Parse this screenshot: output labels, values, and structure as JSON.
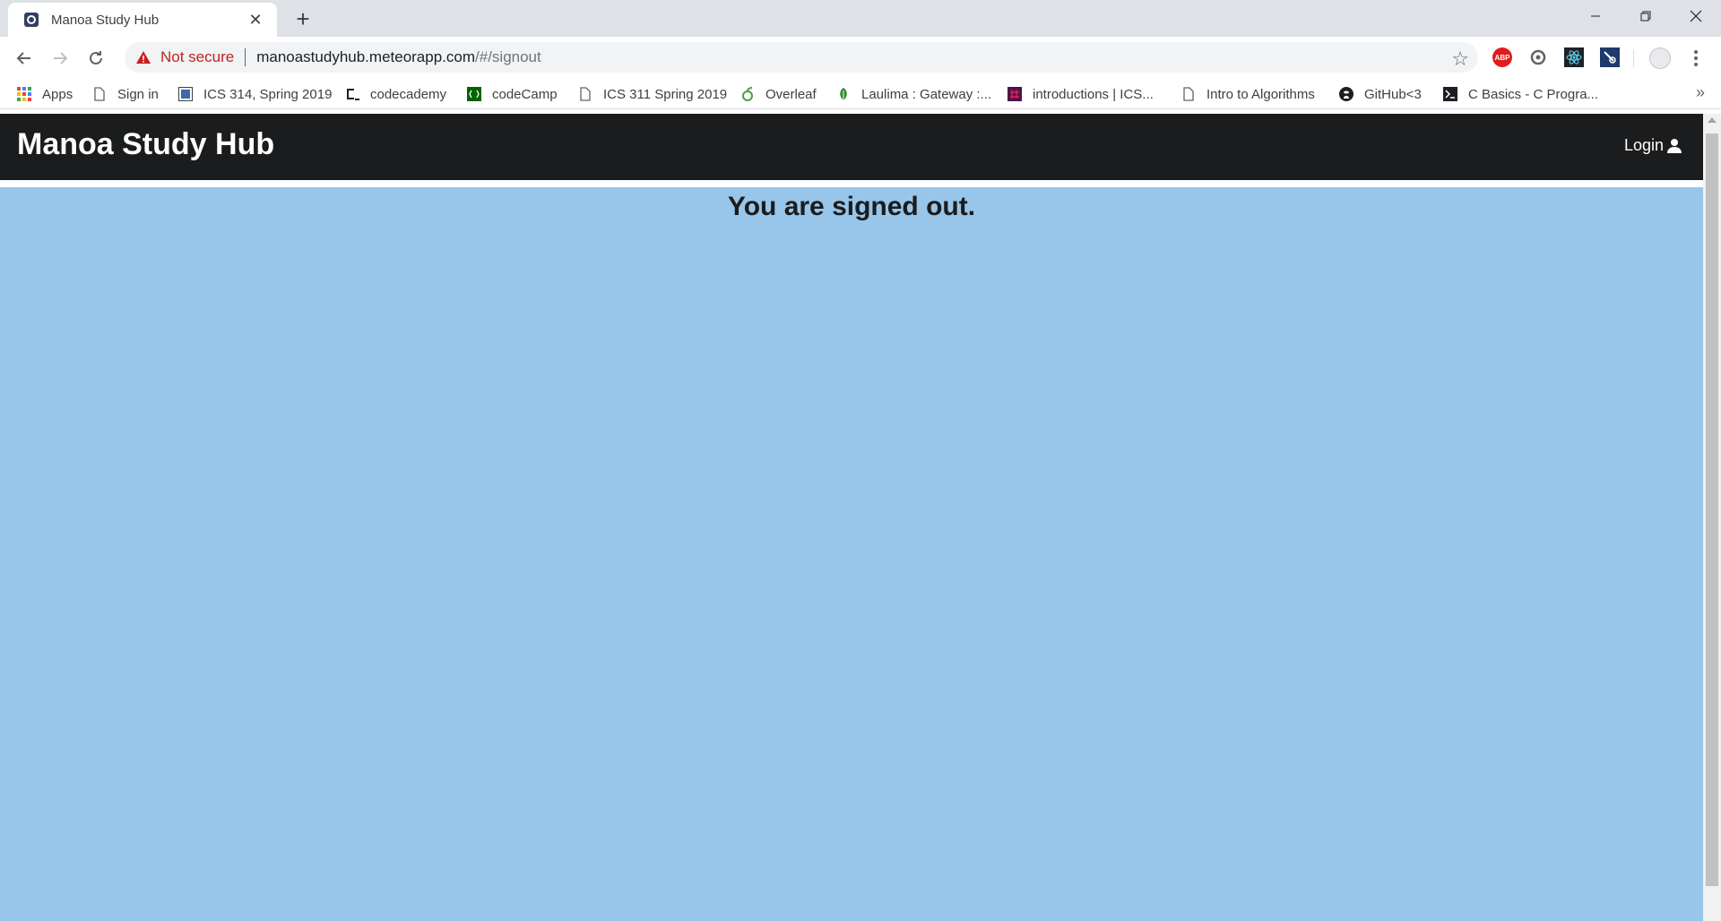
{
  "browser": {
    "tab": {
      "title": "Manoa Study Hub",
      "favicon": "meteor-favicon-icon"
    },
    "new_tab_symbol": "+",
    "window_controls": [
      "minimize-icon",
      "restore-icon",
      "close-icon"
    ],
    "omnibox": {
      "security_label": "Not secure",
      "url_domain": "manoastudyhub.meteorapp.com",
      "url_path": "/#/signout"
    },
    "extensions": [
      "adblock-plus-icon",
      "sync-icon",
      "react-devtools-icon",
      "meteor-devtools-icon"
    ],
    "bookmarks": [
      {
        "label": "Apps",
        "icon": "apps-grid-icon"
      },
      {
        "label": "Sign in",
        "icon": "page-icon"
      },
      {
        "label": "ICS 314, Spring 2019",
        "icon": "square-icon"
      },
      {
        "label": "codecademy",
        "icon": "codecademy-icon"
      },
      {
        "label": "codeCamp",
        "icon": "freecodecamp-icon"
      },
      {
        "label": "ICS 311 Spring 2019",
        "icon": "page-icon"
      },
      {
        "label": "Overleaf",
        "icon": "overleaf-icon"
      },
      {
        "label": "Laulima : Gateway :...",
        "icon": "laulima-leaf-icon"
      },
      {
        "label": "introductions | ICS...",
        "icon": "slack-icon"
      },
      {
        "label": "Intro to Algorithms",
        "icon": "page-icon"
      },
      {
        "label": "GitHub<3",
        "icon": "github-icon"
      },
      {
        "label": "C Basics - C Progra...",
        "icon": "terminal-icon"
      }
    ],
    "bookmarks_overflow": "»"
  },
  "page": {
    "brand": "Manoa Study Hub",
    "login_label": "Login",
    "login_icon": "user-icon",
    "message": "You are signed out."
  },
  "colors": {
    "navbar_bg": "#1b1c1d",
    "page_bg": "#98c6ea",
    "not_secure": "#c5221f"
  }
}
